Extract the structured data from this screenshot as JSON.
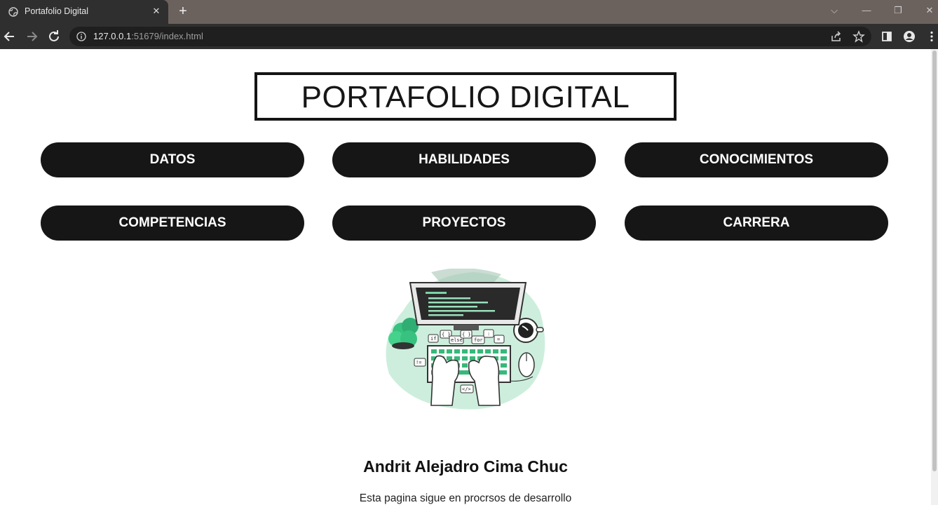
{
  "browser": {
    "tab_title": "Portafolio Digital",
    "url_host": "127.0.0.1",
    "url_port": ":51679",
    "url_path": "/index.html"
  },
  "page": {
    "title": "PORTAFOLIO DIGITAL",
    "nav": [
      {
        "label": "DATOS"
      },
      {
        "label": "HABILIDADES"
      },
      {
        "label": "CONOCIMIENTOS"
      },
      {
        "label": "COMPETENCIAS"
      },
      {
        "label": "PROYECTOS"
      },
      {
        "label": "CARRERA"
      }
    ],
    "illustration": {
      "tokens": [
        "if",
        "{ }",
        "else",
        "{ }",
        "for",
        "=",
        ":",
        "!=",
        "</>"
      ]
    },
    "name": "Andrit Alejadro Cima Chuc",
    "note": "Esta pagina sigue en procrsos de desarrollo"
  },
  "colors": {
    "pill": "#161616",
    "accent_green": "#bfeed6",
    "accent_dark_green": "#2fae74"
  }
}
